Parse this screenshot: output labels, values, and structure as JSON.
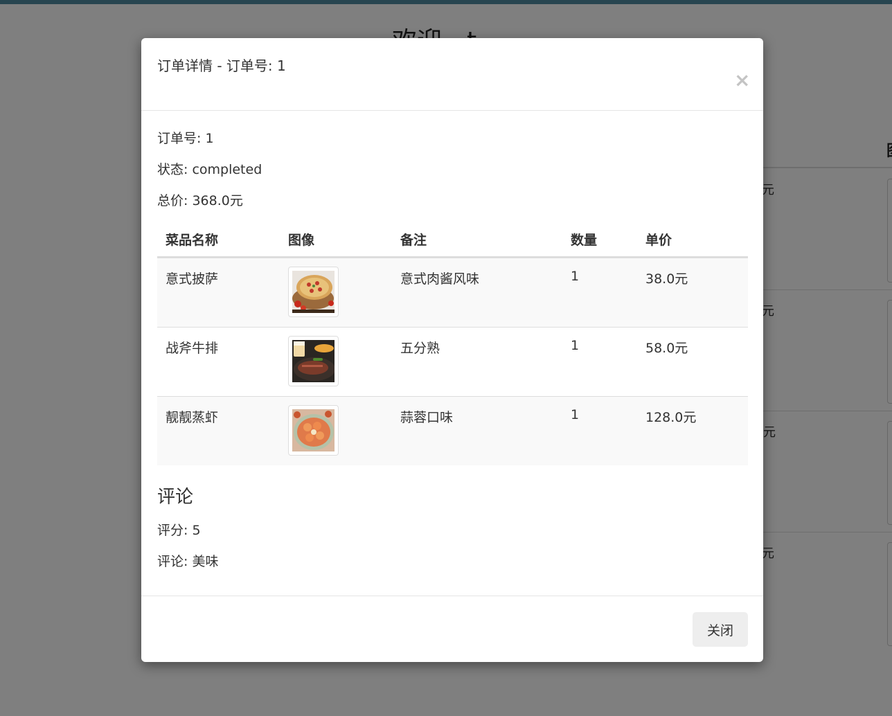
{
  "background": {
    "heading": "欢迎，t",
    "accent_color": "#4f8aa1",
    "price_suffixes": [
      "元",
      "元",
      "元",
      "元"
    ]
  },
  "modal": {
    "title": "订单详情 - 订单号: 1",
    "close_icon": "close-icon",
    "close_glyph": "×",
    "order_number_line": "订单号: 1",
    "status_line": "状态: completed",
    "total_line": "总价: 368.0元",
    "table": {
      "headers": [
        "菜品名称",
        "图像",
        "备注",
        "数量",
        "单价"
      ],
      "rows": [
        {
          "name": "意式披萨",
          "image": "pizza-image",
          "note": "意式肉酱风味",
          "qty": "1",
          "price": "38.0元"
        },
        {
          "name": "战斧牛排",
          "image": "steak-image",
          "note": "五分熟",
          "qty": "1",
          "price": "58.0元"
        },
        {
          "name": "靓靓蒸虾",
          "image": "shrimp-image",
          "note": "蒜蓉口味",
          "qty": "1",
          "price": "128.0元"
        }
      ]
    },
    "review": {
      "title": "评论",
      "rating_line": "评分: 5",
      "comment_line": "评论: 美味"
    },
    "footer": {
      "close_label": "关闭"
    }
  }
}
